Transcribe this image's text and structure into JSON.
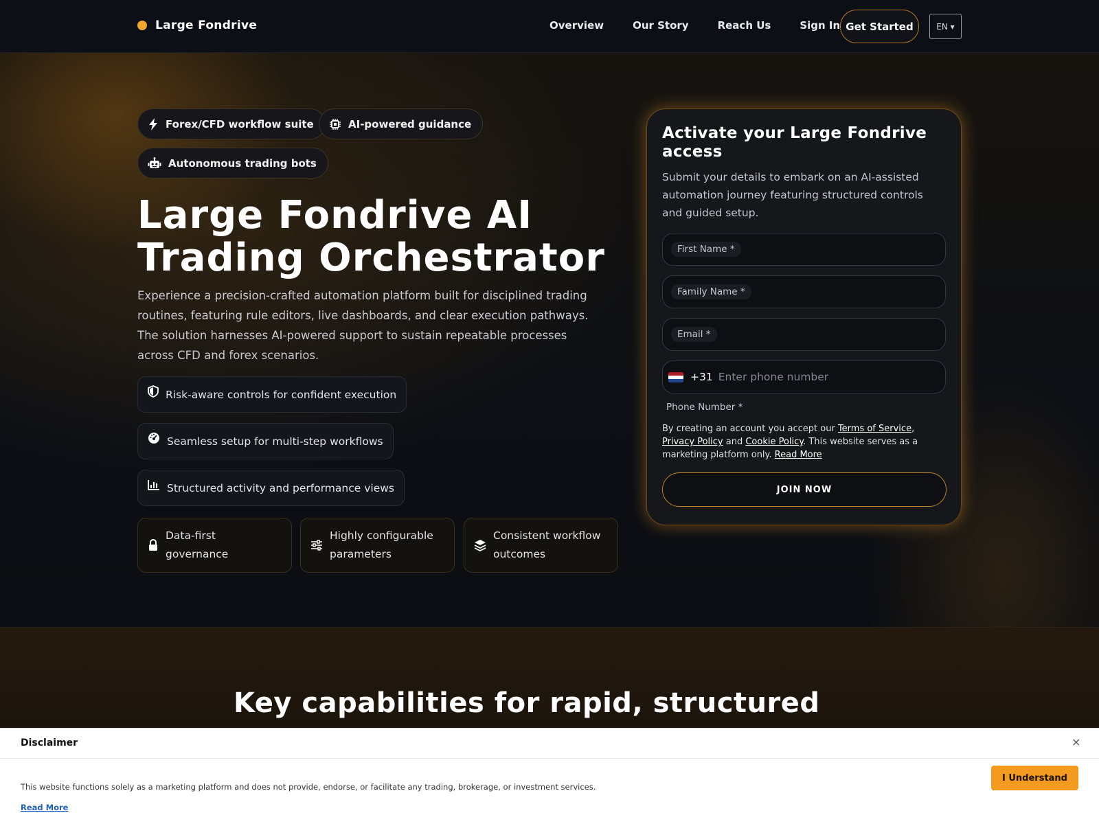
{
  "nav": {
    "brand": "Large Fondrive",
    "links": [
      "Overview",
      "Our Story",
      "Reach Us",
      "Sign In"
    ],
    "cta": "Get Started",
    "language": "EN ▾"
  },
  "hero": {
    "chips": [
      "Forex/CFD workflow suite",
      "AI-powered guidance",
      "Autonomous trading bots"
    ],
    "title": "Large Fondrive AI Trading Orchestrator",
    "description": "Experience a precision-crafted automation platform built for disciplined trading routines, featuring rule editors, live dashboards, and clear execution pathways. The solution harnesses AI-powered support to sustain repeatable processes across CFD and forex scenarios.",
    "features": [
      "Risk-aware controls for confident execution",
      "Seamless setup for multi-step workflows",
      "Structured activity and performance views"
    ],
    "tiles": [
      "Data-first governance",
      "Highly configurable parameters",
      "Consistent workflow outcomes"
    ]
  },
  "form": {
    "title": "Activate your Large Fondrive access",
    "subtitle": "Submit your details to embark on an AI-assisted automation journey featuring structured controls and guided setup.",
    "first_name_label": "First Name *",
    "family_name_label": "Family Name *",
    "email_label": "Email *",
    "phone_code": "+31",
    "phone_placeholder": "Enter phone number",
    "phone_label": "Phone Number *",
    "terms_prefix": "By creating an account you accept our ",
    "terms_link": "Terms of Service",
    "comma": ",",
    "privacy_link": "Privacy Policy",
    "and_text": " and ",
    "cookie_link": "Cookie Policy",
    "terms_suffix": ". This website serves as a marketing platform only. ",
    "read_more": "Read More",
    "submit": "JOIN NOW"
  },
  "section2": {
    "title": "Key capabilities for rapid, structured execution"
  },
  "disclaimer": {
    "title": "Disclaimer",
    "close": "×",
    "text": "This website functions solely as a marketing platform and does not provide, endorse, or facilitate any trading, brokerage, or investment services.",
    "read_more": "Read More",
    "button": "I Understand"
  },
  "icons": {
    "chips": [
      "bolt-icon",
      "chip-icon",
      "robot-icon"
    ],
    "features": [
      "shield-icon",
      "gauge-icon",
      "bar-chart-icon"
    ],
    "tiles": [
      "lock-icon",
      "sliders-icon",
      "layers-icon"
    ]
  },
  "colors": {
    "accent": "#f0a630",
    "button": "#f39b1f",
    "background": "#0b0d12"
  }
}
